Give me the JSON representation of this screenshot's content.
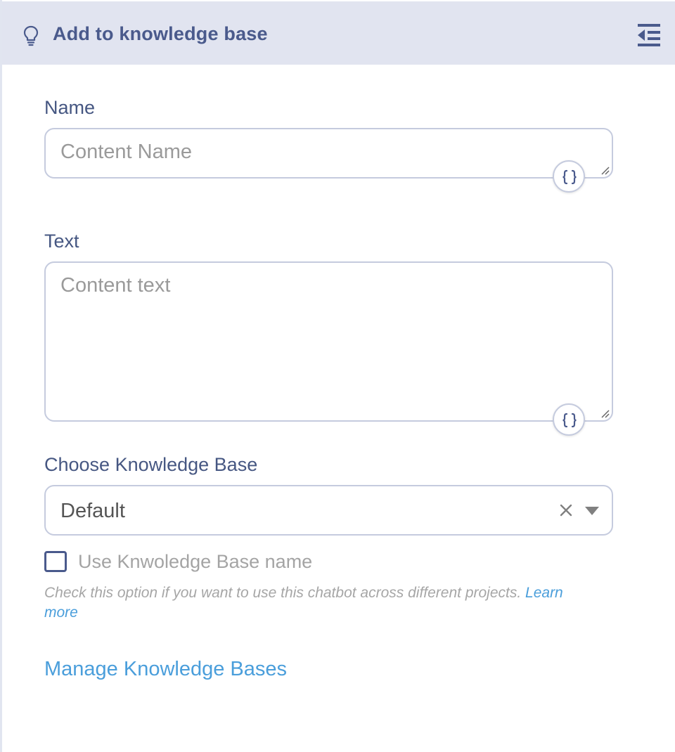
{
  "header": {
    "title": "Add to knowledge base",
    "icon": "lightbulb-icon",
    "collapse_icon": "collapse-panel-icon"
  },
  "name_field": {
    "label": "Name",
    "placeholder": "Content Name",
    "value": "",
    "variable_icon": "curly-braces-icon"
  },
  "text_field": {
    "label": "Text",
    "placeholder": "Content text",
    "value": "",
    "variable_icon": "curly-braces-icon"
  },
  "knowledge_base": {
    "label": "Choose Knowledge Base",
    "selected": "Default",
    "clear_icon": "close-icon",
    "dropdown_icon": "caret-down-icon"
  },
  "use_kb_name": {
    "label": "Use Knwoledge Base name",
    "checked": false,
    "help_text": "Check this option if you want to use this chatbot across different projects.",
    "learn_more_line1": "Learn",
    "learn_more_line2": "more"
  },
  "manage_link": "Manage Knowledge Bases",
  "colors": {
    "header_bg": "#e1e4f0",
    "primary_text": "#4a5a8c",
    "link": "#4a9edb",
    "border": "#c5cbde",
    "placeholder": "#9a9a9a"
  }
}
